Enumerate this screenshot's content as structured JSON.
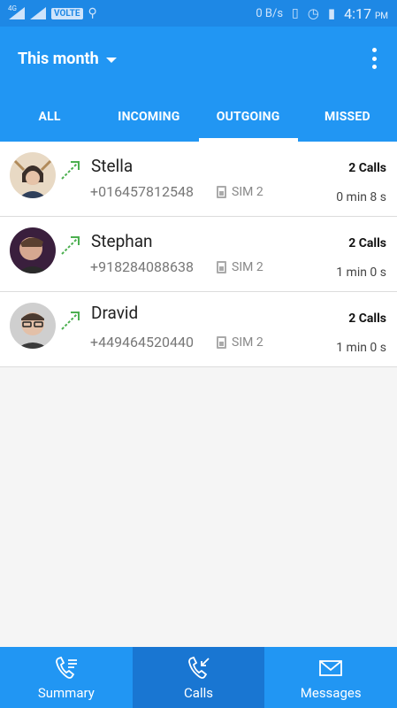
{
  "status_bar": {
    "network": "4G",
    "volte": "VOLTE",
    "data_speed": "0 B/s",
    "time": "4:17",
    "ampm": "PM"
  },
  "app_bar": {
    "title": "This month"
  },
  "tabs": [
    {
      "label": "ALL",
      "active": false
    },
    {
      "label": "INCOMING",
      "active": false
    },
    {
      "label": "OUTGOING",
      "active": true
    },
    {
      "label": "MISSED",
      "active": false
    }
  ],
  "calls": [
    {
      "name": "Stella",
      "number": "+016457812548",
      "sim": "SIM 2",
      "count": "2 Calls",
      "duration": "0 min 8 s",
      "type": "outgoing"
    },
    {
      "name": "Stephan",
      "number": "+918284088638",
      "sim": "SIM 2",
      "count": "2 Calls",
      "duration": "1 min 0 s",
      "type": "outgoing"
    },
    {
      "name": "Dravid",
      "number": "+449464520440",
      "sim": "SIM 2",
      "count": "2 Calls",
      "duration": "1 min 0 s",
      "type": "outgoing"
    }
  ],
  "bottom_nav": [
    {
      "label": "Summary",
      "icon": "phone-list-icon",
      "active": false
    },
    {
      "label": "Calls",
      "icon": "phone-calls-icon",
      "active": true
    },
    {
      "label": "Messages",
      "icon": "envelope-icon",
      "active": false
    }
  ],
  "colors": {
    "primary": "#2196F3",
    "status_bar": "#1E88E5",
    "nav_active": "#1976D2",
    "outgoing_arrow": "#4CAF50"
  }
}
